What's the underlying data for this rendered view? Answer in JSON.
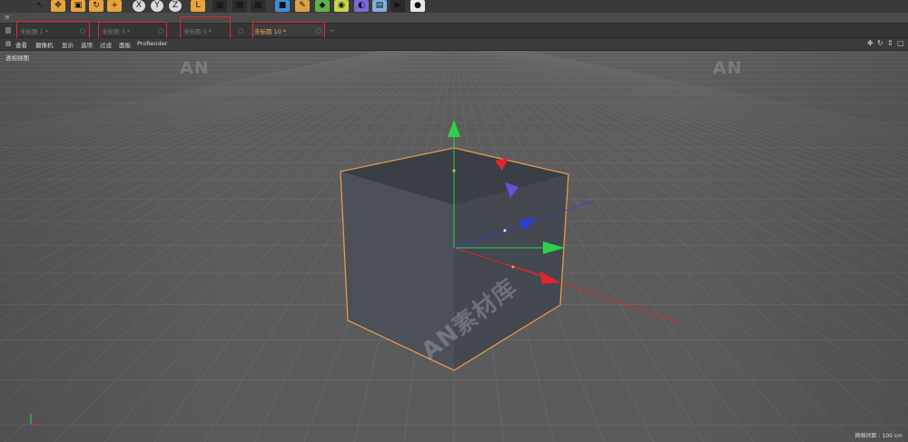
{
  "toolbar": {
    "icons": [
      {
        "name": "cursor-icon",
        "glyph": "↖",
        "color": "#3d3d3d"
      },
      {
        "name": "move-icon",
        "glyph": "✥",
        "color": "#e8a33b"
      },
      {
        "name": "scale-icon",
        "glyph": "▣",
        "color": "#e8a33b"
      },
      {
        "name": "rotate-icon",
        "glyph": "↻",
        "color": "#e8a33b"
      },
      {
        "name": "add-icon",
        "glyph": "+",
        "color": "#e8a33b"
      },
      {
        "name": "x-axis-icon",
        "glyph": "X",
        "color": "#d9d9d9"
      },
      {
        "name": "y-axis-icon",
        "glyph": "Y",
        "color": "#d9d9d9"
      },
      {
        "name": "z-axis-icon",
        "glyph": "Z",
        "color": "#d9d9d9"
      },
      {
        "name": "coordinate-system-icon",
        "glyph": "L",
        "color": "#e8a33b"
      },
      {
        "name": "render-view-icon",
        "glyph": "▦",
        "color": "#2c2c2c"
      },
      {
        "name": "render-picture-viewer-icon",
        "glyph": "▦",
        "color": "#2c2c2c"
      },
      {
        "name": "render-settings-icon",
        "glyph": "▦",
        "color": "#2c2c2c"
      },
      {
        "name": "cube-primitive-icon",
        "glyph": "■",
        "color": "#3c8fd8"
      },
      {
        "name": "pen-spline-icon",
        "glyph": "✎",
        "color": "#d8a14a"
      },
      {
        "name": "subdivision-icon",
        "glyph": "◆",
        "color": "#5fb04a"
      },
      {
        "name": "cloner-icon",
        "glyph": "◉",
        "color": "#c5d44a"
      },
      {
        "name": "deformer-icon",
        "glyph": "◐",
        "color": "#7a6ad8"
      },
      {
        "name": "floor-icon",
        "glyph": "▤",
        "color": "#7fb0e0"
      },
      {
        "name": "camera-icon",
        "glyph": "▶",
        "color": "#2a2a2a"
      },
      {
        "name": "light-icon",
        "glyph": "●",
        "color": "#e8e8e8"
      }
    ]
  },
  "strip": {
    "mark": "≡"
  },
  "tabs": [
    {
      "label": "未标题 1 *",
      "close": "○",
      "active": false
    },
    {
      "label": "未标题 3 *",
      "close": "○",
      "active": false
    },
    {
      "label": "未标题 9 *",
      "close": "○",
      "active": false
    },
    {
      "label": "未标题 10 *",
      "close": "○",
      "active": true
    }
  ],
  "tab_add": "+",
  "viewport_menu": {
    "items": [
      "查看",
      "摄像机",
      "显示",
      "选项",
      "过滤",
      "面板",
      "ProRender"
    ],
    "controls": [
      "✥",
      "↻",
      "⇕",
      "▢"
    ]
  },
  "viewport": {
    "label": "透视视图",
    "grid_spacing": "网格间距 : 100 cm",
    "watermarks": [
      "AN",
      "AN",
      "AN素材库"
    ]
  },
  "colors": {
    "highlight": "#e0272e",
    "active_tab_text": "#e9a84e",
    "selection_outline": "#e39a4a",
    "axis_x": "#e0262b",
    "axis_y": "#2fcf4a",
    "axis_z": "#2b3fe0"
  }
}
